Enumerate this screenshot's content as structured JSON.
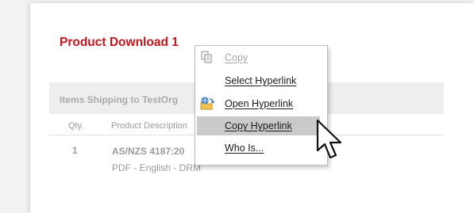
{
  "page": {
    "product_title": "Product Download 1",
    "shipping_label": "Items Shipping to TestOrg",
    "columns": {
      "qty": "Qty.",
      "description": "Product Description"
    },
    "item": {
      "qty": "1",
      "code": "AS/NZS 4187:20",
      "format": "PDF - English - DRM"
    }
  },
  "context_menu": {
    "items": [
      {
        "label": "Copy",
        "enabled": false,
        "icon": "copy-icon"
      },
      {
        "label": "Select Hyperlink",
        "enabled": true
      },
      {
        "label": "Open Hyperlink",
        "enabled": true,
        "icon": "open-hyperlink-icon"
      },
      {
        "label": "Copy Hyperlink",
        "enabled": true,
        "highlighted": true
      },
      {
        "label": "Who Is...",
        "enabled": true
      }
    ]
  },
  "colors": {
    "accent_red": "#c3161c",
    "highlight": "#cacaca",
    "muted_text": "#9a9a9a"
  },
  "cursor": {
    "icon": "arrow-pointer-icon"
  }
}
